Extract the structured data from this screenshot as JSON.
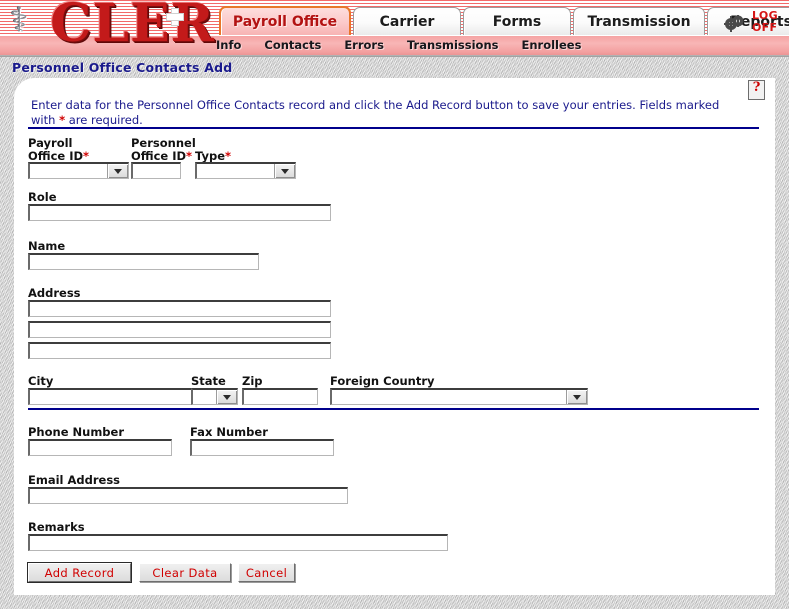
{
  "app": {
    "logo_text": "CLER",
    "caduceus_icon": "caduceus-icon",
    "gear_icon": "gear-icon",
    "logoff_line1": "LOG",
    "logoff_line2": "OFF"
  },
  "tabs": [
    {
      "label": "Payroll Office",
      "active": true
    },
    {
      "label": "Carrier",
      "active": false
    },
    {
      "label": "Forms",
      "active": false
    },
    {
      "label": "Transmission",
      "active": false
    },
    {
      "label": "Reports",
      "active": false
    }
  ],
  "subnav": [
    {
      "label": "Info"
    },
    {
      "label": "Contacts"
    },
    {
      "label": "Errors"
    },
    {
      "label": "Transmissions"
    },
    {
      "label": "Enrollees"
    }
  ],
  "page": {
    "title": "Personnel Office Contacts Add",
    "help_icon": "help-question-icon",
    "help_glyph": "?",
    "instruction_part1": "Enter data for the Personnel Office Contacts record and click the Add Record button to save your entries.  Fields marked with ",
    "instruction_star": "*",
    "instruction_part2": " are required."
  },
  "form": {
    "payroll_office_id": {
      "label": "Payroll",
      "label2": "Office ID",
      "required": "*",
      "value": "",
      "type": "select"
    },
    "personnel_office_id": {
      "label": "Personnel",
      "label2": "Office ID",
      "required": "*",
      "value": "",
      "type": "text"
    },
    "contact_type": {
      "label": "Type",
      "required": "*",
      "value": "",
      "type": "select"
    },
    "role": {
      "label": "Role",
      "value": ""
    },
    "name": {
      "label": "Name",
      "value": ""
    },
    "address": {
      "label": "Address",
      "line1": "",
      "line2": "",
      "line3": ""
    },
    "city": {
      "label": "City",
      "value": ""
    },
    "state": {
      "label": "State",
      "value": ""
    },
    "zip": {
      "label": "Zip",
      "value": ""
    },
    "foreign_country": {
      "label": "Foreign Country",
      "value": ""
    },
    "phone_number": {
      "label": "Phone Number",
      "value": ""
    },
    "fax_number": {
      "label": "Fax Number",
      "value": ""
    },
    "email_address": {
      "label": "Email Address",
      "value": ""
    },
    "remarks": {
      "label": "Remarks",
      "value": ""
    }
  },
  "buttons": {
    "add_record": "Add Record",
    "clear_data": "Clear Data",
    "cancel": "Cancel"
  },
  "colors": {
    "brand_red": "#c31a1a",
    "title_blue": "#1a1a8c",
    "divider_blue": "#00008c",
    "required_red": "#d00000",
    "active_tab_border": "#e8762a"
  }
}
